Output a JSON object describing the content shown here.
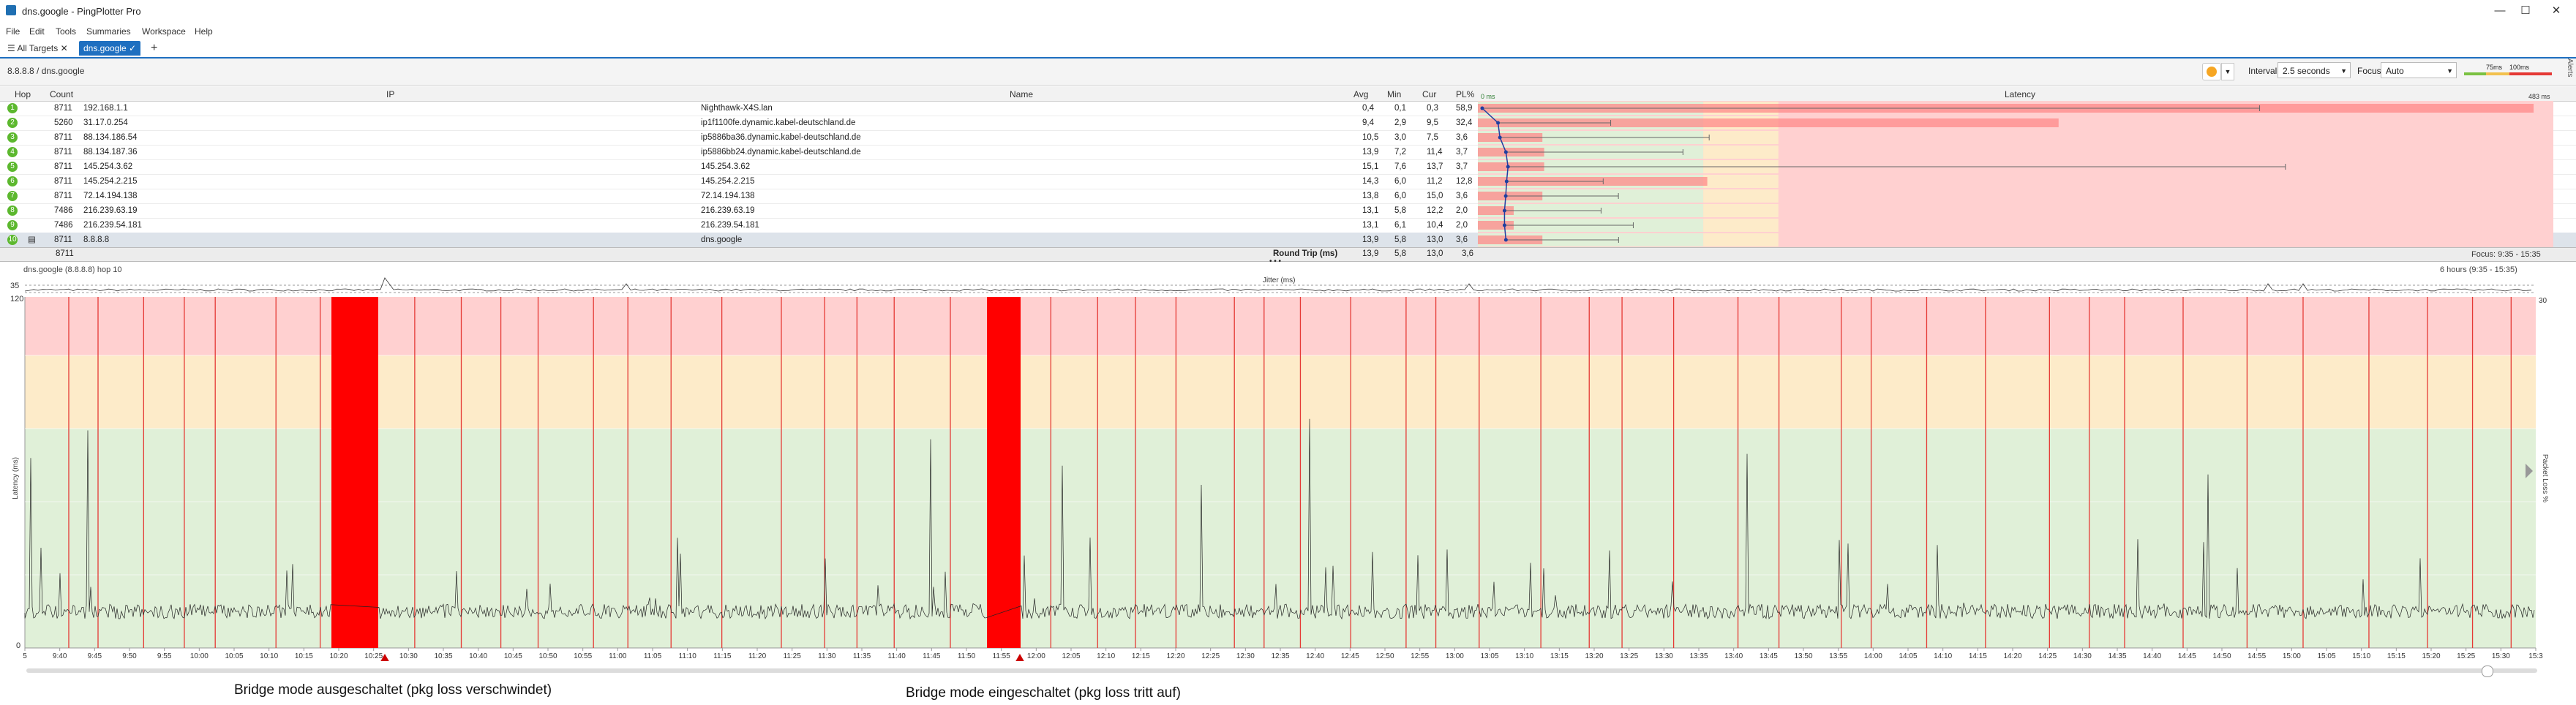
{
  "window": {
    "title": "dns.google - PingPlotter Pro",
    "buttons": [
      "—",
      "☐",
      "✕"
    ]
  },
  "menu": [
    "File",
    "Edit",
    "Tools",
    "Summaries",
    "Workspace",
    "Help"
  ],
  "tabs": {
    "all_targets": "All Targets",
    "active": "dns.google",
    "add": "+"
  },
  "toolbar": {
    "breadcrumb": "8.8.8.8 / dns.google",
    "interval_label": "Interval",
    "interval_value": "2.5 seconds",
    "focus_label": "Focus",
    "focus_value": "Auto",
    "scale_75": "75ms",
    "scale_100": "100ms",
    "side_tab": "Alerts"
  },
  "columns": {
    "hop": "Hop",
    "count": "Count",
    "ip": "IP",
    "name": "Name",
    "avg": "Avg",
    "min": "Min",
    "cur": "Cur",
    "pl": "PL%",
    "latency": "Latency",
    "lat_min": "0 ms",
    "lat_max": "483 ms"
  },
  "hops": [
    {
      "hop": "1",
      "count": "8711",
      "ip": "192.168.1.1",
      "name": "Nighthawk-X4S.lan",
      "avg": "0,4",
      "min": "0,1",
      "cur": "0,3",
      "pl": "58,9",
      "plv": 58.9,
      "avgv": 0.4,
      "maxv": 483
    },
    {
      "hop": "2",
      "count": "5260",
      "ip": "31.17.0.254",
      "name": "ip1f1100fe.dynamic.kabel-deutschland.de",
      "avg": "9,4",
      "min": "2,9",
      "cur": "9,5",
      "pl": "32,4",
      "plv": 32.4,
      "avgv": 9.4,
      "maxv": 70
    },
    {
      "hop": "3",
      "count": "8711",
      "ip": "88.134.186.54",
      "name": "ip5886ba36.dynamic.kabel-deutschland.de",
      "avg": "10,5",
      "min": "3,0",
      "cur": "7,5",
      "pl": "3,6",
      "plv": 3.6,
      "avgv": 10.5,
      "maxv": 130
    },
    {
      "hop": "4",
      "count": "8711",
      "ip": "88.134.187.36",
      "name": "ip5886bb24.dynamic.kabel-deutschland.de",
      "avg": "13,9",
      "min": "7,2",
      "cur": "11,4",
      "pl": "3,7",
      "plv": 3.7,
      "avgv": 13.9,
      "maxv": 110
    },
    {
      "hop": "5",
      "count": "8711",
      "ip": "145.254.3.62",
      "name": "145.254.3.62",
      "avg": "15,1",
      "min": "7,6",
      "cur": "13,7",
      "pl": "3,7",
      "plv": 3.7,
      "avgv": 15.1,
      "maxv": 483
    },
    {
      "hop": "6",
      "count": "8711",
      "ip": "145.254.2.215",
      "name": "145.254.2.215",
      "avg": "14,3",
      "min": "6,0",
      "cur": "11,2",
      "pl": "12,8",
      "plv": 12.8,
      "avgv": 14.3,
      "maxv": 60
    },
    {
      "hop": "7",
      "count": "8711",
      "ip": "72.14.194.138",
      "name": "72.14.194.138",
      "avg": "13,8",
      "min": "6,0",
      "cur": "15,0",
      "pl": "3,6",
      "plv": 3.6,
      "avgv": 13.8,
      "maxv": 70
    },
    {
      "hop": "8",
      "count": "7486",
      "ip": "216.239.63.19",
      "name": "216.239.63.19",
      "avg": "13,1",
      "min": "5,8",
      "cur": "12,2",
      "pl": "2,0",
      "plv": 2.0,
      "avgv": 13.1,
      "maxv": 60
    },
    {
      "hop": "9",
      "count": "7486",
      "ip": "216.239.54.181",
      "name": "216.239.54.181",
      "avg": "13,1",
      "min": "6,1",
      "cur": "10,4",
      "pl": "2,0",
      "plv": 2.0,
      "avgv": 13.1,
      "maxv": 80
    },
    {
      "hop": "10",
      "count": "8711",
      "ip": "8.8.8.8",
      "name": "dns.google",
      "avg": "13,9",
      "min": "5,8",
      "cur": "13,0",
      "pl": "3,6",
      "plv": 3.6,
      "avgv": 13.9,
      "maxv": 70
    }
  ],
  "summary": {
    "count": "8711",
    "label": "Round Trip (ms)",
    "avg": "13,9",
    "min": "5,8",
    "cur": "13,0",
    "pl": "3,6",
    "focus": "Focus: 9:35 - 15:35"
  },
  "graph": {
    "caption": "dns.google (8.8.8.8) hop 10",
    "range": "6 hours (9:35 - 15:35)",
    "jitter_label": "Jitter (ms)",
    "jitter_max": "35",
    "y_max": "120",
    "y_min": "0",
    "y_title": "Latency (ms)",
    "right_title": "Packet Loss %",
    "right_max": "30",
    "x_ticks": [
      "5",
      "9:40",
      "9:45",
      "9:50",
      "9:55",
      "10:00",
      "10:05",
      "10:10",
      "10:15",
      "10:20",
      "10:25",
      "10:30",
      "10:35",
      "10:40",
      "10:45",
      "10:50",
      "10:55",
      "11:00",
      "11:05",
      "11:10",
      "11:15",
      "11:20",
      "11:25",
      "11:30",
      "11:35",
      "11:40",
      "11:45",
      "11:50",
      "11:55",
      "12:00",
      "12:05",
      "12:10",
      "12:15",
      "12:20",
      "12:25",
      "12:30",
      "12:35",
      "12:40",
      "12:45",
      "12:50",
      "12:55",
      "13:00",
      "13:05",
      "13:10",
      "13:15",
      "13:20",
      "13:25",
      "13:30",
      "13:35",
      "13:40",
      "13:45",
      "13:50",
      "13:55",
      "14:00",
      "14:05",
      "14:10",
      "14:15",
      "14:20",
      "14:25",
      "14:30",
      "14:35",
      "14:40",
      "14:45",
      "14:50",
      "14:55",
      "15:00",
      "15:05",
      "15:10",
      "15:15",
      "15:20",
      "15:25",
      "15:30",
      "15:3"
    ]
  },
  "annotations": {
    "left": "Bridge mode ausgeschaltet (pkg loss verschwindet)",
    "right": "Bridge mode eingeschaltet (pkg loss tritt auf)"
  },
  "colors": {
    "accent": "#1e6fc0",
    "hop_ok": "#5cb82e",
    "loss": "#ff0000",
    "zone_red": "#ffd0d0",
    "zone_yellow": "#fdebc9",
    "zone_green": "#e0f0d8"
  }
}
